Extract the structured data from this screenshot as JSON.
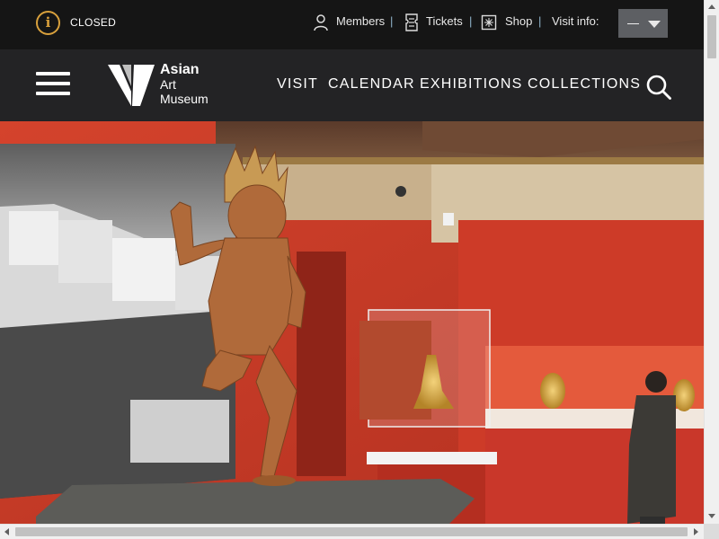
{
  "status": {
    "hours_label": "CLOSED",
    "info_icon_glyph": "i"
  },
  "utility_links": [
    {
      "label": "Members",
      "icon": "person-icon"
    },
    {
      "label": "Tickets",
      "icon": "ticket-icon"
    },
    {
      "label": "Shop",
      "icon": "shop-icon"
    },
    {
      "label": "Visit info:",
      "icon": ""
    }
  ],
  "separator": "|",
  "language_select": {
    "value": "—"
  },
  "logo": {
    "line1": "Asian",
    "line2": "Art",
    "line3": "Museum"
  },
  "nav": [
    {
      "label": "VISIT"
    },
    {
      "label": "CALENDAR"
    },
    {
      "label": "EXHIBITIONS"
    },
    {
      "label": "COLLECTIONS"
    }
  ],
  "hero": {
    "image_subject": "gallery-photo"
  },
  "colors": {
    "topbar_bg": "#151515",
    "nav_bg": "#232325",
    "accent_gold": "#d8a03c",
    "separator_blue": "#8fb2c9",
    "gallery_red": "#c63a28"
  }
}
